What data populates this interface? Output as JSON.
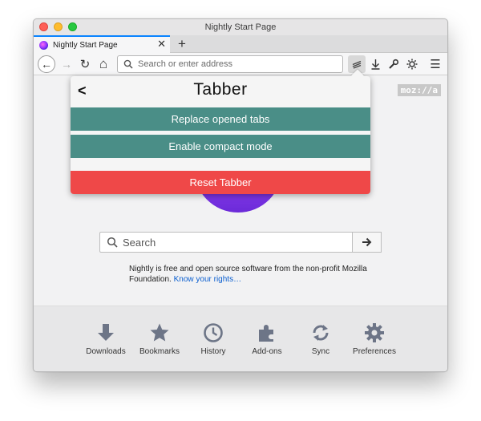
{
  "window": {
    "title": "Nightly Start Page"
  },
  "tabs": [
    {
      "label": "Nightly Start Page",
      "close": "✕"
    }
  ],
  "new_tab_label": "+",
  "navbar": {
    "back_glyph": "←",
    "forward_glyph": "→",
    "reload_glyph": "↻",
    "home_glyph": "⌂",
    "url_placeholder": "Search or enter address",
    "menu_glyph": "☰"
  },
  "brand_badge": "moz://a",
  "search": {
    "placeholder": "Search"
  },
  "about": {
    "text": "Nightly is free and open source software from the non-profit Mozilla Foundation.",
    "link": "Know your rights…"
  },
  "launchers": [
    {
      "label": "Downloads",
      "icon": "download-icon"
    },
    {
      "label": "Bookmarks",
      "icon": "star-icon"
    },
    {
      "label": "History",
      "icon": "clock-icon"
    },
    {
      "label": "Add-ons",
      "icon": "puzzle-icon"
    },
    {
      "label": "Sync",
      "icon": "sync-icon"
    },
    {
      "label": "Preferences",
      "icon": "gear-icon"
    }
  ],
  "popup": {
    "back_glyph": "<",
    "title": "Tabber",
    "buttons": {
      "replace": "Replace opened tabs",
      "compact": "Enable compact mode",
      "reset": "Reset Tabber"
    }
  },
  "colors": {
    "accent_tab": "#0a84ff",
    "teal_button": "#4a8e87",
    "reset_button": "#ef4848"
  }
}
